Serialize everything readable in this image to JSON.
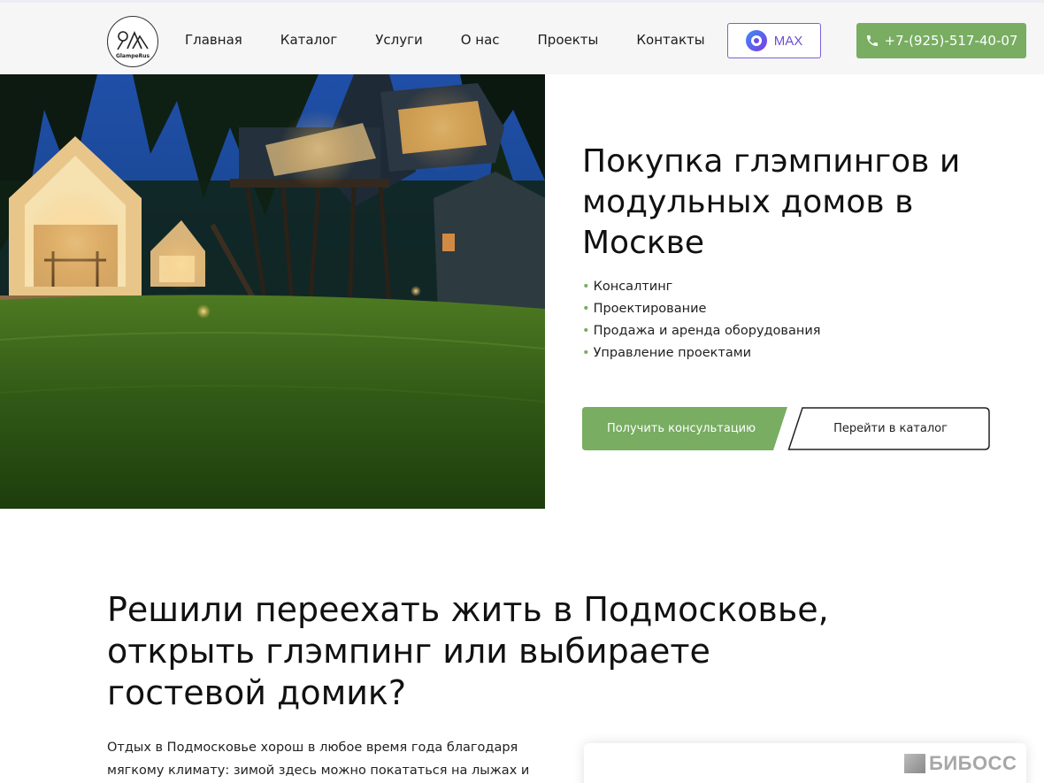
{
  "brand": {
    "logo_text": "GlampeRus"
  },
  "nav": {
    "items": [
      "Главная",
      "Каталог",
      "Услуги",
      "О нас",
      "Проекты",
      "Контакты"
    ]
  },
  "header": {
    "max_label": "MAX",
    "phone": "+7-(925)-517-40-07"
  },
  "hero": {
    "title": "Покупка глэмпингов и модульных домов в Москве",
    "services": [
      "Консалтинг",
      "Проектирование",
      "Продажа и аренда оборудования",
      "Управление проектами"
    ],
    "consult_button": "Получить консультацию",
    "catalog_button": "Перейти в каталог"
  },
  "section2": {
    "title": "Решили переехать жить в Подмосковье, открыть глэмпинг или выбираете гостевой домик?",
    "text": "Отдых в Подмосковье хорош в любое время года благодаря мягкому климату: зимой здесь можно покататься на лыжах и"
  },
  "watermark": "БИБОСС",
  "colors": {
    "accent_green": "#78ad62",
    "max_purple": "#6c4ed8",
    "header_bg": "#f6f6f6"
  }
}
